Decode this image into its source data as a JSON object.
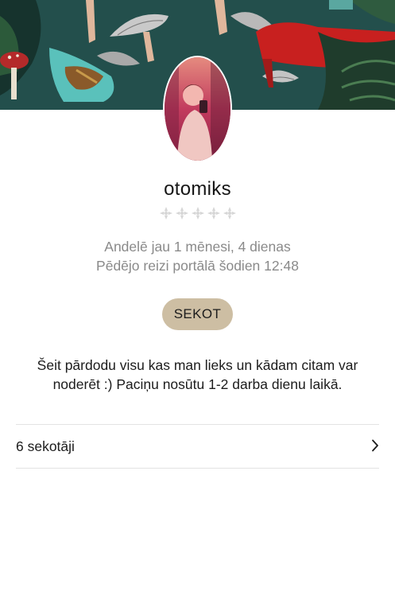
{
  "profile": {
    "username": "otomiks",
    "rating": {
      "filled": 0,
      "max": 5
    },
    "member_since": "Andelē jau 1 mēnesi, 4 dienas",
    "last_seen": "Pēdējo reizi portālā šodien 12:48",
    "follow_label": "SEKOT",
    "bio": "Šeit pārdodu visu kas man lieks un kādam citam var noderēt :) Paciņu nosūtu 1-2 darba dienu laikā.",
    "followers_label": "6 sekotāji"
  },
  "icons": {
    "rating": "ornament-star-icon",
    "followers_arrow": "chevron-right-icon"
  },
  "colors": {
    "follow_button": "#cdbea3",
    "rating_empty": "#d6d6d6",
    "meta_text": "#8a8a8a",
    "cover_background": "#234f4c"
  }
}
